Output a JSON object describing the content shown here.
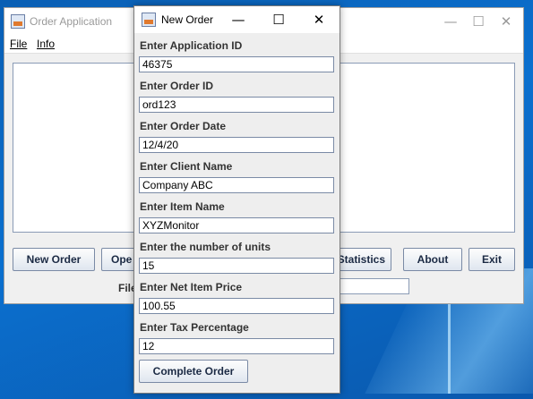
{
  "main_window": {
    "title": "Order Application",
    "menu": [
      "File",
      "Info"
    ],
    "buttons": {
      "new_order": "New Order",
      "open_partial": "Ope",
      "statistics": "Statistics",
      "about": "About",
      "exit": "Exit"
    },
    "file_label_partial": "File",
    "file_field_value": ""
  },
  "dialog": {
    "title": "New Order",
    "controls": {
      "minimize": "—",
      "maximize": "☐",
      "close": "✕"
    },
    "fields": [
      {
        "label": "Enter Application ID",
        "value": "46375"
      },
      {
        "label": "Enter Order ID",
        "value": "ord123"
      },
      {
        "label": "Enter Order Date",
        "value": "12/4/20"
      },
      {
        "label": "Enter Client Name",
        "value": "Company ABC"
      },
      {
        "label": "Enter Item Name",
        "value": "XYZMonitor"
      },
      {
        "label": "Enter the number of units",
        "value": "15"
      },
      {
        "label": "Enter Net Item Price",
        "value": "100.55"
      },
      {
        "label": "Enter Tax Percentage",
        "value": "12"
      }
    ],
    "submit_label": "Complete Order"
  }
}
